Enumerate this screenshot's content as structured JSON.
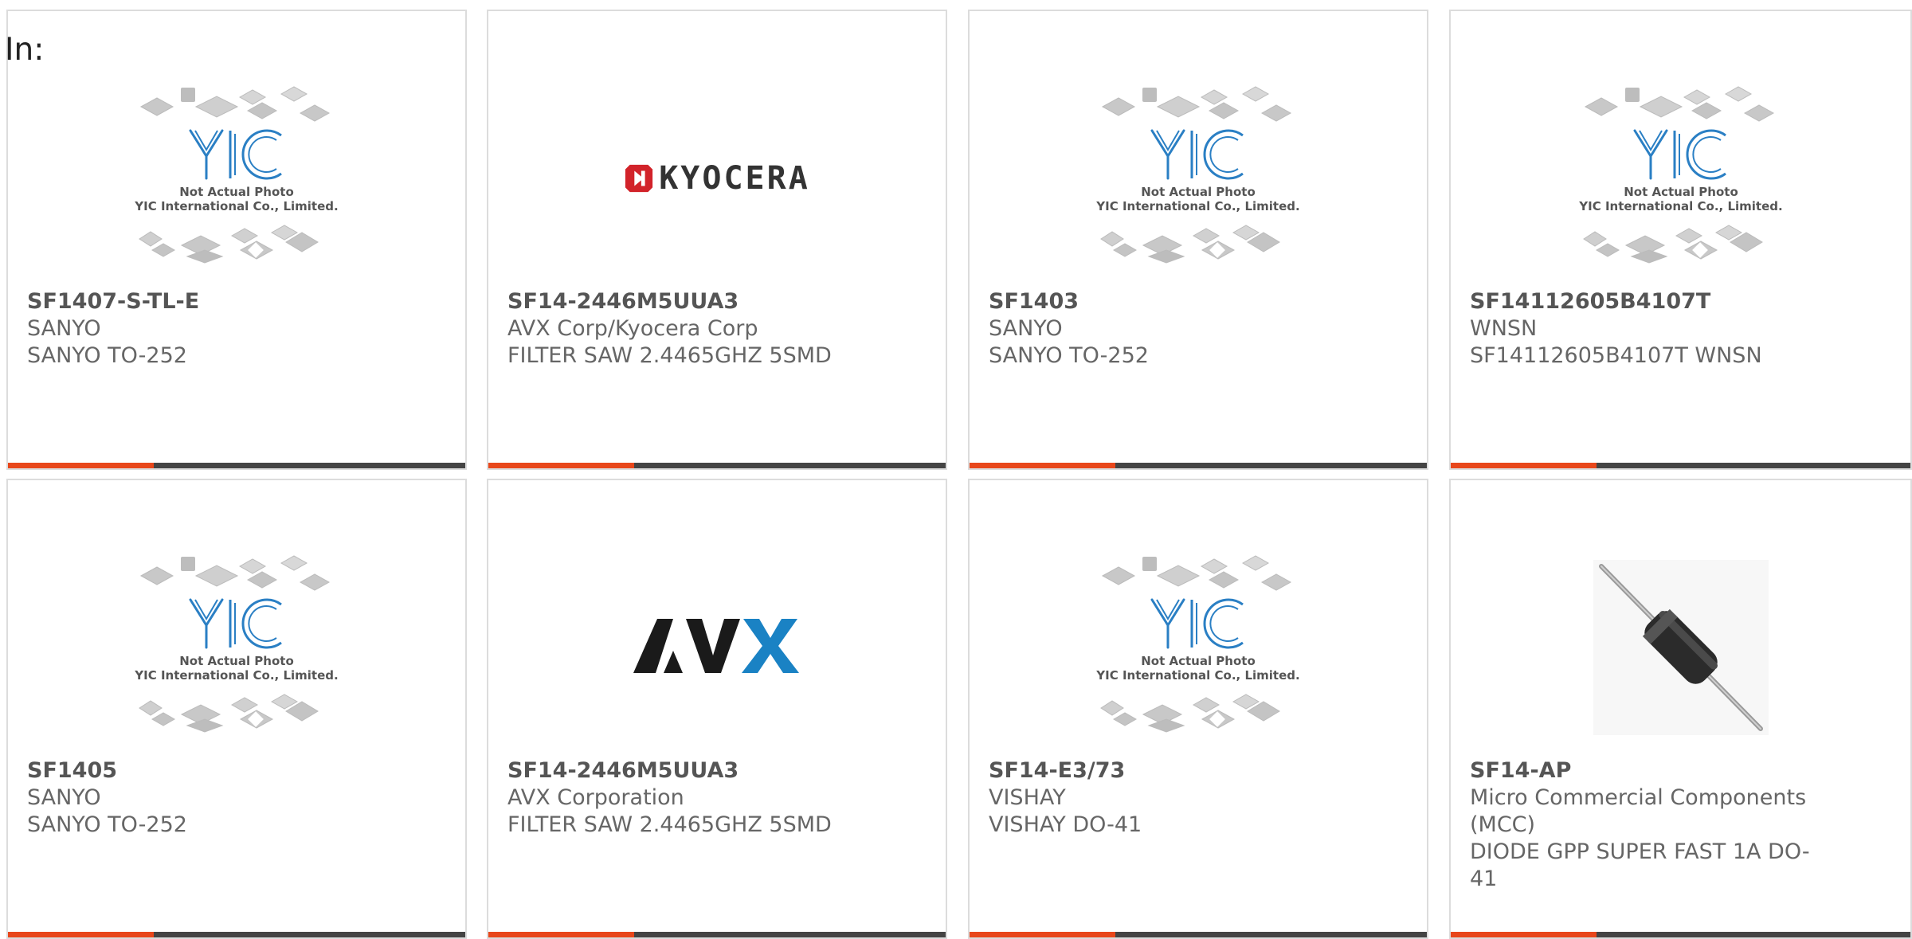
{
  "header": {
    "label": "In:"
  },
  "placeholder": {
    "line1": "Not Actual Photo",
    "line2": "YIC International Co., Limited.",
    "brand": "YIC"
  },
  "colors": {
    "accent": "#e8471b",
    "bar": "#444444",
    "yic_blue": "#2a7fc4"
  },
  "products": [
    {
      "part": "SF1407-S-TL-E",
      "mfr": "SANYO",
      "desc": "SANYO TO-252",
      "image": "yic-placeholder"
    },
    {
      "part": "SF14-2446M5UUA3",
      "mfr": "AVX Corp/Kyocera Corp",
      "desc": "FILTER SAW 2.4465GHZ 5SMD",
      "image": "kyocera-logo",
      "logo_text": "KYOCERA"
    },
    {
      "part": "SF1403",
      "mfr": "SANYO",
      "desc": "SANYO TO-252",
      "image": "yic-placeholder"
    },
    {
      "part": "SF14112605B4107T",
      "mfr": "WNSN",
      "desc": "SF14112605B4107T WNSN",
      "image": "yic-placeholder"
    },
    {
      "part": "SF1405",
      "mfr": "SANYO",
      "desc": "SANYO TO-252",
      "image": "yic-placeholder"
    },
    {
      "part": "SF14-2446M5UUA3",
      "mfr": "AVX Corporation",
      "desc": "FILTER SAW 2.4465GHZ 5SMD",
      "image": "avx-logo",
      "logo_text": "AVX"
    },
    {
      "part": "SF14-E3/73",
      "mfr": "VISHAY",
      "desc": "VISHAY DO-41",
      "image": "yic-placeholder"
    },
    {
      "part": "SF14-AP",
      "mfr": "Micro Commercial Components (MCC)",
      "desc": "DIODE GPP SUPER FAST 1A DO-41",
      "image": "diode-photo"
    }
  ]
}
